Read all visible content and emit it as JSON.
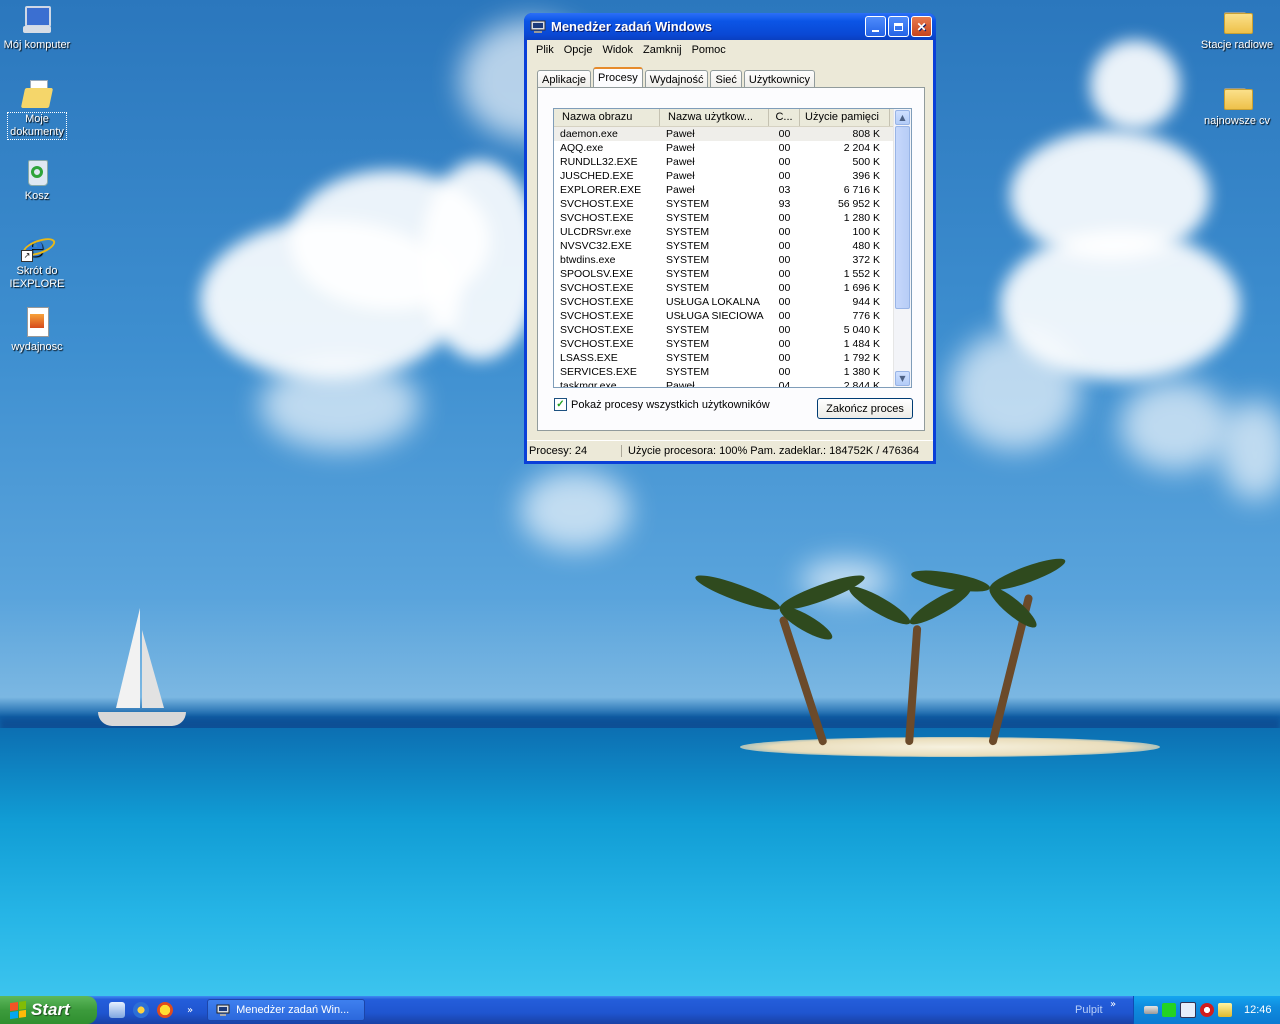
{
  "desktop": {
    "icons": [
      {
        "label": "Mój komputer",
        "icon": "computer-icon"
      },
      {
        "label": "Moje dokumenty",
        "icon": "documents-folder-icon"
      },
      {
        "label": "Kosz",
        "icon": "recycle-bin-icon"
      },
      {
        "label": "Skrót do IEXPLORE",
        "icon": "internet-explorer-icon"
      },
      {
        "label": "wydajnosc",
        "icon": "image-file-icon"
      },
      {
        "label": "Stacje radiowe",
        "icon": "folder-icon"
      },
      {
        "label": "najnowsze cv",
        "icon": "folder-icon"
      }
    ]
  },
  "window": {
    "title": "Menedżer zadań Windows",
    "menu": [
      "Plik",
      "Opcje",
      "Widok",
      "Zamknij",
      "Pomoc"
    ],
    "tabs": [
      {
        "label": "Aplikacje",
        "active": false
      },
      {
        "label": "Procesy",
        "active": true
      },
      {
        "label": "Wydajność",
        "active": false
      },
      {
        "label": "Sieć",
        "active": false
      },
      {
        "label": "Użytkownicy",
        "active": false
      }
    ],
    "columns": [
      "Nazwa obrazu",
      "Nazwa użytkow...",
      "C...",
      "Użycie pamięci"
    ],
    "processes": [
      [
        "daemon.exe",
        "Paweł",
        "00",
        "808 K"
      ],
      [
        "AQQ.exe",
        "Paweł",
        "00",
        "2 204 K"
      ],
      [
        "RUNDLL32.EXE",
        "Paweł",
        "00",
        "500 K"
      ],
      [
        "JUSCHED.EXE",
        "Paweł",
        "00",
        "396 K"
      ],
      [
        "EXPLORER.EXE",
        "Paweł",
        "03",
        "6 716 K"
      ],
      [
        "SVCHOST.EXE",
        "SYSTEM",
        "93",
        "56 952 K"
      ],
      [
        "SVCHOST.EXE",
        "SYSTEM",
        "00",
        "1 280 K"
      ],
      [
        "ULCDRSvr.exe",
        "SYSTEM",
        "00",
        "100 K"
      ],
      [
        "NVSVC32.EXE",
        "SYSTEM",
        "00",
        "480 K"
      ],
      [
        "btwdins.exe",
        "SYSTEM",
        "00",
        "372 K"
      ],
      [
        "SPOOLSV.EXE",
        "SYSTEM",
        "00",
        "1 552 K"
      ],
      [
        "SVCHOST.EXE",
        "SYSTEM",
        "00",
        "1 696 K"
      ],
      [
        "SVCHOST.EXE",
        "USŁUGA LOKALNA",
        "00",
        "944 K"
      ],
      [
        "SVCHOST.EXE",
        "USŁUGA SIECIOWA",
        "00",
        "776 K"
      ],
      [
        "SVCHOST.EXE",
        "SYSTEM",
        "00",
        "5 040 K"
      ],
      [
        "SVCHOST.EXE",
        "SYSTEM",
        "00",
        "1 484 K"
      ],
      [
        "LSASS.EXE",
        "SYSTEM",
        "00",
        "1 792 K"
      ],
      [
        "SERVICES.EXE",
        "SYSTEM",
        "00",
        "1 380 K"
      ],
      [
        "taskmgr.exe",
        "Paweł",
        "04",
        "2 844 K"
      ]
    ],
    "show_all_label": "Pokaż procesy wszystkich użytkowników",
    "show_all_checked": true,
    "end_process_label": "Zakończ proces",
    "status": {
      "processes": "Procesy: 24",
      "cpu_and_mem": "Użycie procesora: 100% Pam. zadeklar.: 184752K / 476364"
    }
  },
  "taskbar": {
    "start_label": "Start",
    "task_button": "Menedżer zadań Win...",
    "toolbar_label": "Pulpit",
    "clock": "12:46"
  }
}
